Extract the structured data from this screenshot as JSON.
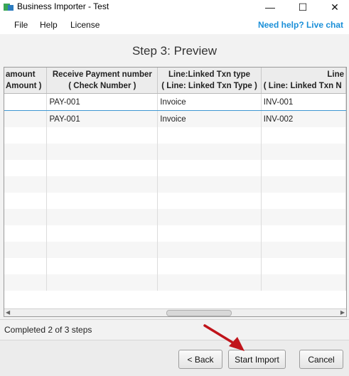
{
  "window": {
    "title": "Business Importer - Test",
    "minimize": "—",
    "maximize": "☐",
    "close": "✕"
  },
  "menu": {
    "items": [
      "File",
      "Help",
      "License"
    ],
    "help_link": "Need help? Live chat"
  },
  "page": {
    "title": "Step 3: Preview"
  },
  "table": {
    "columns": [
      {
        "line1": "amount",
        "line2": "Amount )"
      },
      {
        "line1": "Receive Payment number",
        "line2": "( Check Number )"
      },
      {
        "line1": "Line:Linked Txn type",
        "line2": "( Line: Linked Txn Type )"
      },
      {
        "line1": "Line",
        "line2": "( Line: Linked Txn N"
      }
    ],
    "rows": [
      [
        "",
        "PAY-001",
        "Invoice",
        "INV-001"
      ],
      [
        "",
        "PAY-001",
        "Invoice",
        "INV-002"
      ]
    ]
  },
  "status": {
    "text": "Completed 2 of 3 steps"
  },
  "buttons": {
    "back": "< Back",
    "start_import": "Start Import",
    "cancel": "Cancel"
  },
  "colors": {
    "link": "#1a8fd8",
    "selection": "#3f97d2",
    "annotation_arrow": "#c0141b"
  }
}
